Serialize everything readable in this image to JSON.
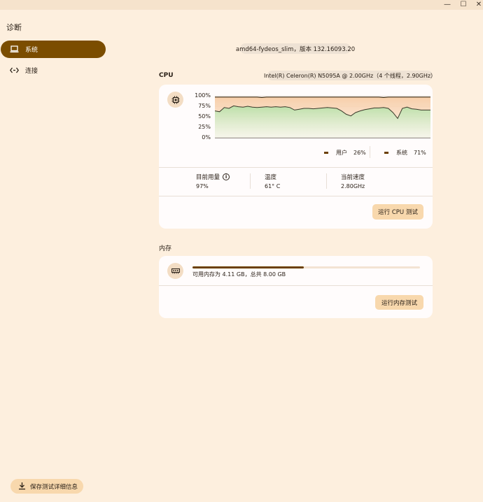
{
  "window": {
    "minimize": "—",
    "maximize": "☐",
    "close": "✕"
  },
  "app_title": "诊断",
  "nav": [
    {
      "label": "系统",
      "icon": "laptop-icon",
      "active": true
    },
    {
      "label": "连接",
      "icon": "code-arrows-icon",
      "active": false
    }
  ],
  "device_chip": "amd64-fydeos_slim，版本 132.16093.20",
  "cpu": {
    "title": "CPU",
    "model_chip": "Intel(R) Celeron(R) N5095A @ 2.00GHz（4 个线程，2.90GHz）",
    "icon": "cpu-chip-icon",
    "y_ticks": [
      "100%",
      "75%",
      "50%",
      "25%",
      "0%"
    ],
    "legend": [
      {
        "label": "用户",
        "value": "26%"
      },
      {
        "label": "系统",
        "value": "71%"
      }
    ],
    "stats": [
      {
        "label": "目前用量",
        "value": "97%",
        "has_info": true
      },
      {
        "label": "温度",
        "value": "61° C",
        "has_info": false
      },
      {
        "label": "当前速度",
        "value": "2.80GHz",
        "has_info": false
      }
    ],
    "run_button": "运行 CPU 测试"
  },
  "memory": {
    "title": "内存",
    "icon": "memory-module-icon",
    "usage_fraction": 0.49,
    "text": "可用内存为 4.11 GB，总共 8.00 GB",
    "run_button": "运行内存测试"
  },
  "save_button": "保存测试详细信息",
  "chart_data": {
    "type": "area",
    "title": "",
    "xlabel": "",
    "ylabel": "",
    "ylim": [
      0,
      100
    ],
    "y_ticks": [
      0,
      25,
      50,
      75,
      100
    ],
    "series": [
      {
        "name": "用户",
        "values": [
          64,
          62,
          72,
          70,
          76,
          74,
          73,
          75,
          73,
          72,
          73,
          74,
          73,
          74,
          73,
          74,
          72,
          66,
          68,
          70,
          70,
          69,
          70,
          71,
          72,
          71,
          70,
          64,
          56,
          52,
          60,
          64,
          67,
          69,
          71,
          71,
          72,
          70,
          60,
          46,
          70,
          73,
          69,
          68,
          66,
          66,
          66
        ]
      },
      {
        "name": "系统",
        "values": [
          97,
          97,
          97,
          97,
          97,
          97,
          97,
          97,
          97,
          97,
          96,
          97,
          97,
          97,
          97,
          97,
          97,
          97,
          97,
          97,
          97,
          97,
          97,
          97,
          97,
          97,
          97,
          97,
          97,
          97,
          97,
          97,
          97,
          97,
          97,
          97,
          96,
          97,
          97,
          97,
          97,
          97,
          97,
          97,
          97,
          97,
          97
        ]
      }
    ]
  }
}
